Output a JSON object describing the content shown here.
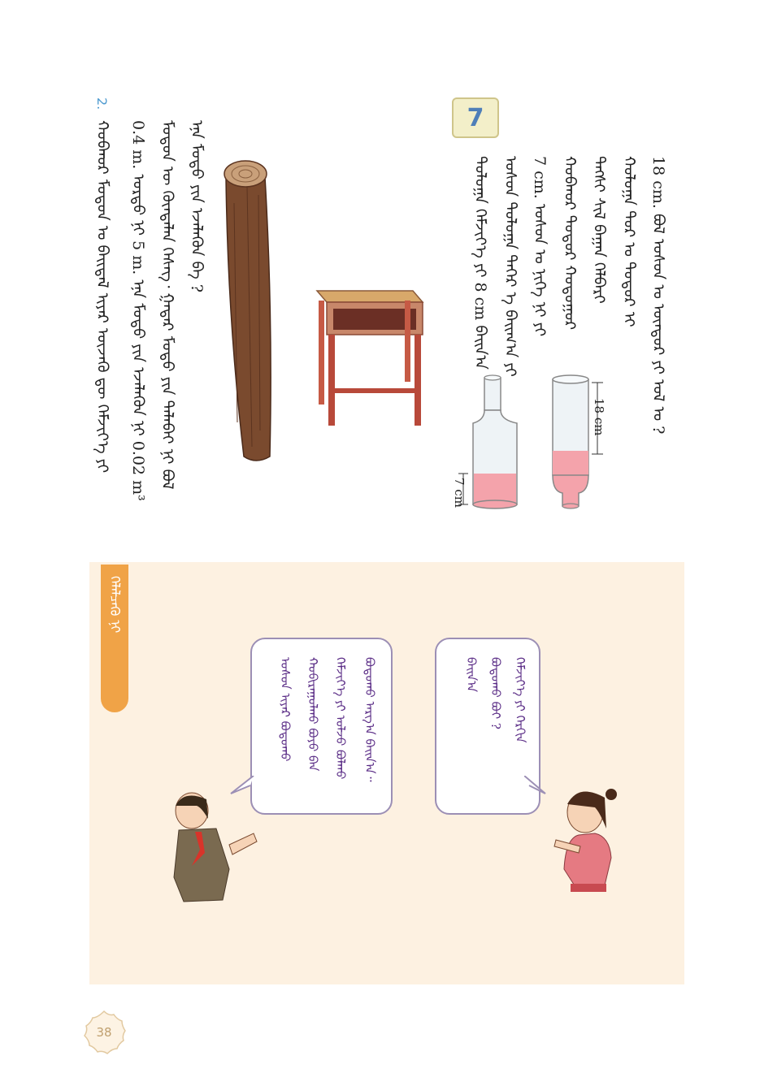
{
  "problem7": {
    "number": "7",
    "columns": [
      "18 cm. ᠪᠣᠯ ᠤᠰᠤᠨ ᠤ ᠥᠨᠳᠥᠷ ᠶᠢ ᠣᠯ ᠤ ?",
      "ᠬᠤᠯᠤᠭᠠ ᠳᠤᠷ ᠤ ᠳᠤᠲᠤᠷ ᠢ",
      "ᠲᠡᠭᠰᠢ ᠰᠢᠯ ᠪᠠᠭᠠᠨ ᠬᠡᠯᠪᠡᠷᠢ",
      "ᠬᠣᠪᠬᠣᠷ ᠳᠣᠲᠣᠷ ᠬᠤᠲᠤᠭᠤᠷ",
      "7 cm. ᠤᠰᠤᠨ ᠤ ᠨᠢᠭᠡ ᠨᠢ ᠶᠢ",
      "ᠤᠰᠤᠨ ᠲᠤᠯᠤᠭᠠ ᠳᠡᠭᠡᠷ ᠡ ᠪᠠᠢᠭ᠎ᠠ ᠶᠢ",
      "ᠲᠤᠯᠤᠭᠠ ᠬᠡᠮᠵᠢᠶ᠎ᠡ ᠶᠢ 8 cm ᠪᠠᠢᠨ᠎ᠠ"
    ],
    "bottle_labels": {
      "height_top": "18 cm",
      "height_bottom": "7 cm"
    }
  },
  "log_problem": {
    "columns": [
      "ᠡᠨᠡ ᠮᠣᠳᠣ ᠶᠢᠨ ᠡᠵᠡᠯᠡᠬᠦᠨ ᠪᠠ ?",
      "ᠮᠣᠳᠣᠨ ᠦ ᠬᠥᠨᠳᠡᠯᠡᠨ ᠬᠡᠰᠡᠭ᠂ ᠭᠠᠳᠠᠷ ᠮᠣᠳᠣ ᠶᠢᠨ ᠲᠠᠯᠠᠪᠠᠢ ᠨᠢ ᠪᠣᠯ",
      "0.4 m. ᠤᠷᠲᠤ ᠨᠢ 5 m. ᠡᠨᠡ ᠮᠣᠳᠣ ᠶᠢᠨ ᠡᠵᠡᠯᠡᠬᠦᠨ ᠨᠢ 0.02 m³"
    ]
  },
  "problem2": {
    "number": "2.",
    "columns": [
      "ᠬᠣᠪᠬᠣᠷ ᠮᠣᠳᠣᠨ ᠤ ᠪᠠᠢᠳᠠᠯ ᠢᠶᠠᠷ ᠦᠵᠡᠬᠦ ᠳᠦ ᠬᠡᠮᠵᠢᠶ᠎ᠡ ᠶᠢ"
    ]
  },
  "discussion": {
    "tag": "ᠬᠡᠯᠡᠯᠴᠡᠬᠦ ᠨᠢ",
    "girl_bubble": [
      "ᠬᠡᠮᠵᠢᠶ᠎ᠡ ᠶᠢ ᠬᠡᠷᠬᠢᠨ",
      "ᠪᠣᠳᠣᠬᠤ ᠪᠤᠢ ?",
      "ᠪᠠᠢᠨ᠎ᠠ"
    ],
    "boy_bubble": [
      "ᠪᠣᠳᠣᠬᠤ ᠠᠷᠭ᠎ᠠ ᠪᠠᠢᠨ᠎ᠠ᠃",
      "ᠬᠡᠮᠵᠢᠶ᠎ᠡ ᠶᠢ ᠣᠯᠵᠤ ᠪᠣᠯᠬᠤ",
      "ᠬᠤᠪᠢᠷᠠᠭᠤᠯᠬᠤ ᠪᠤᠶᠤ ᠪᠡᠨ",
      "ᠤᠰᠤᠨ ᠢᠶᠠᠷ ᠪᠣᠳᠣᠬᠤ"
    ]
  },
  "page_number": "38",
  "colors": {
    "panel": "#fdf1e1",
    "tag": "#f0a347",
    "accent": "#4f7fb8",
    "bubble_text": "#5a2c86"
  }
}
